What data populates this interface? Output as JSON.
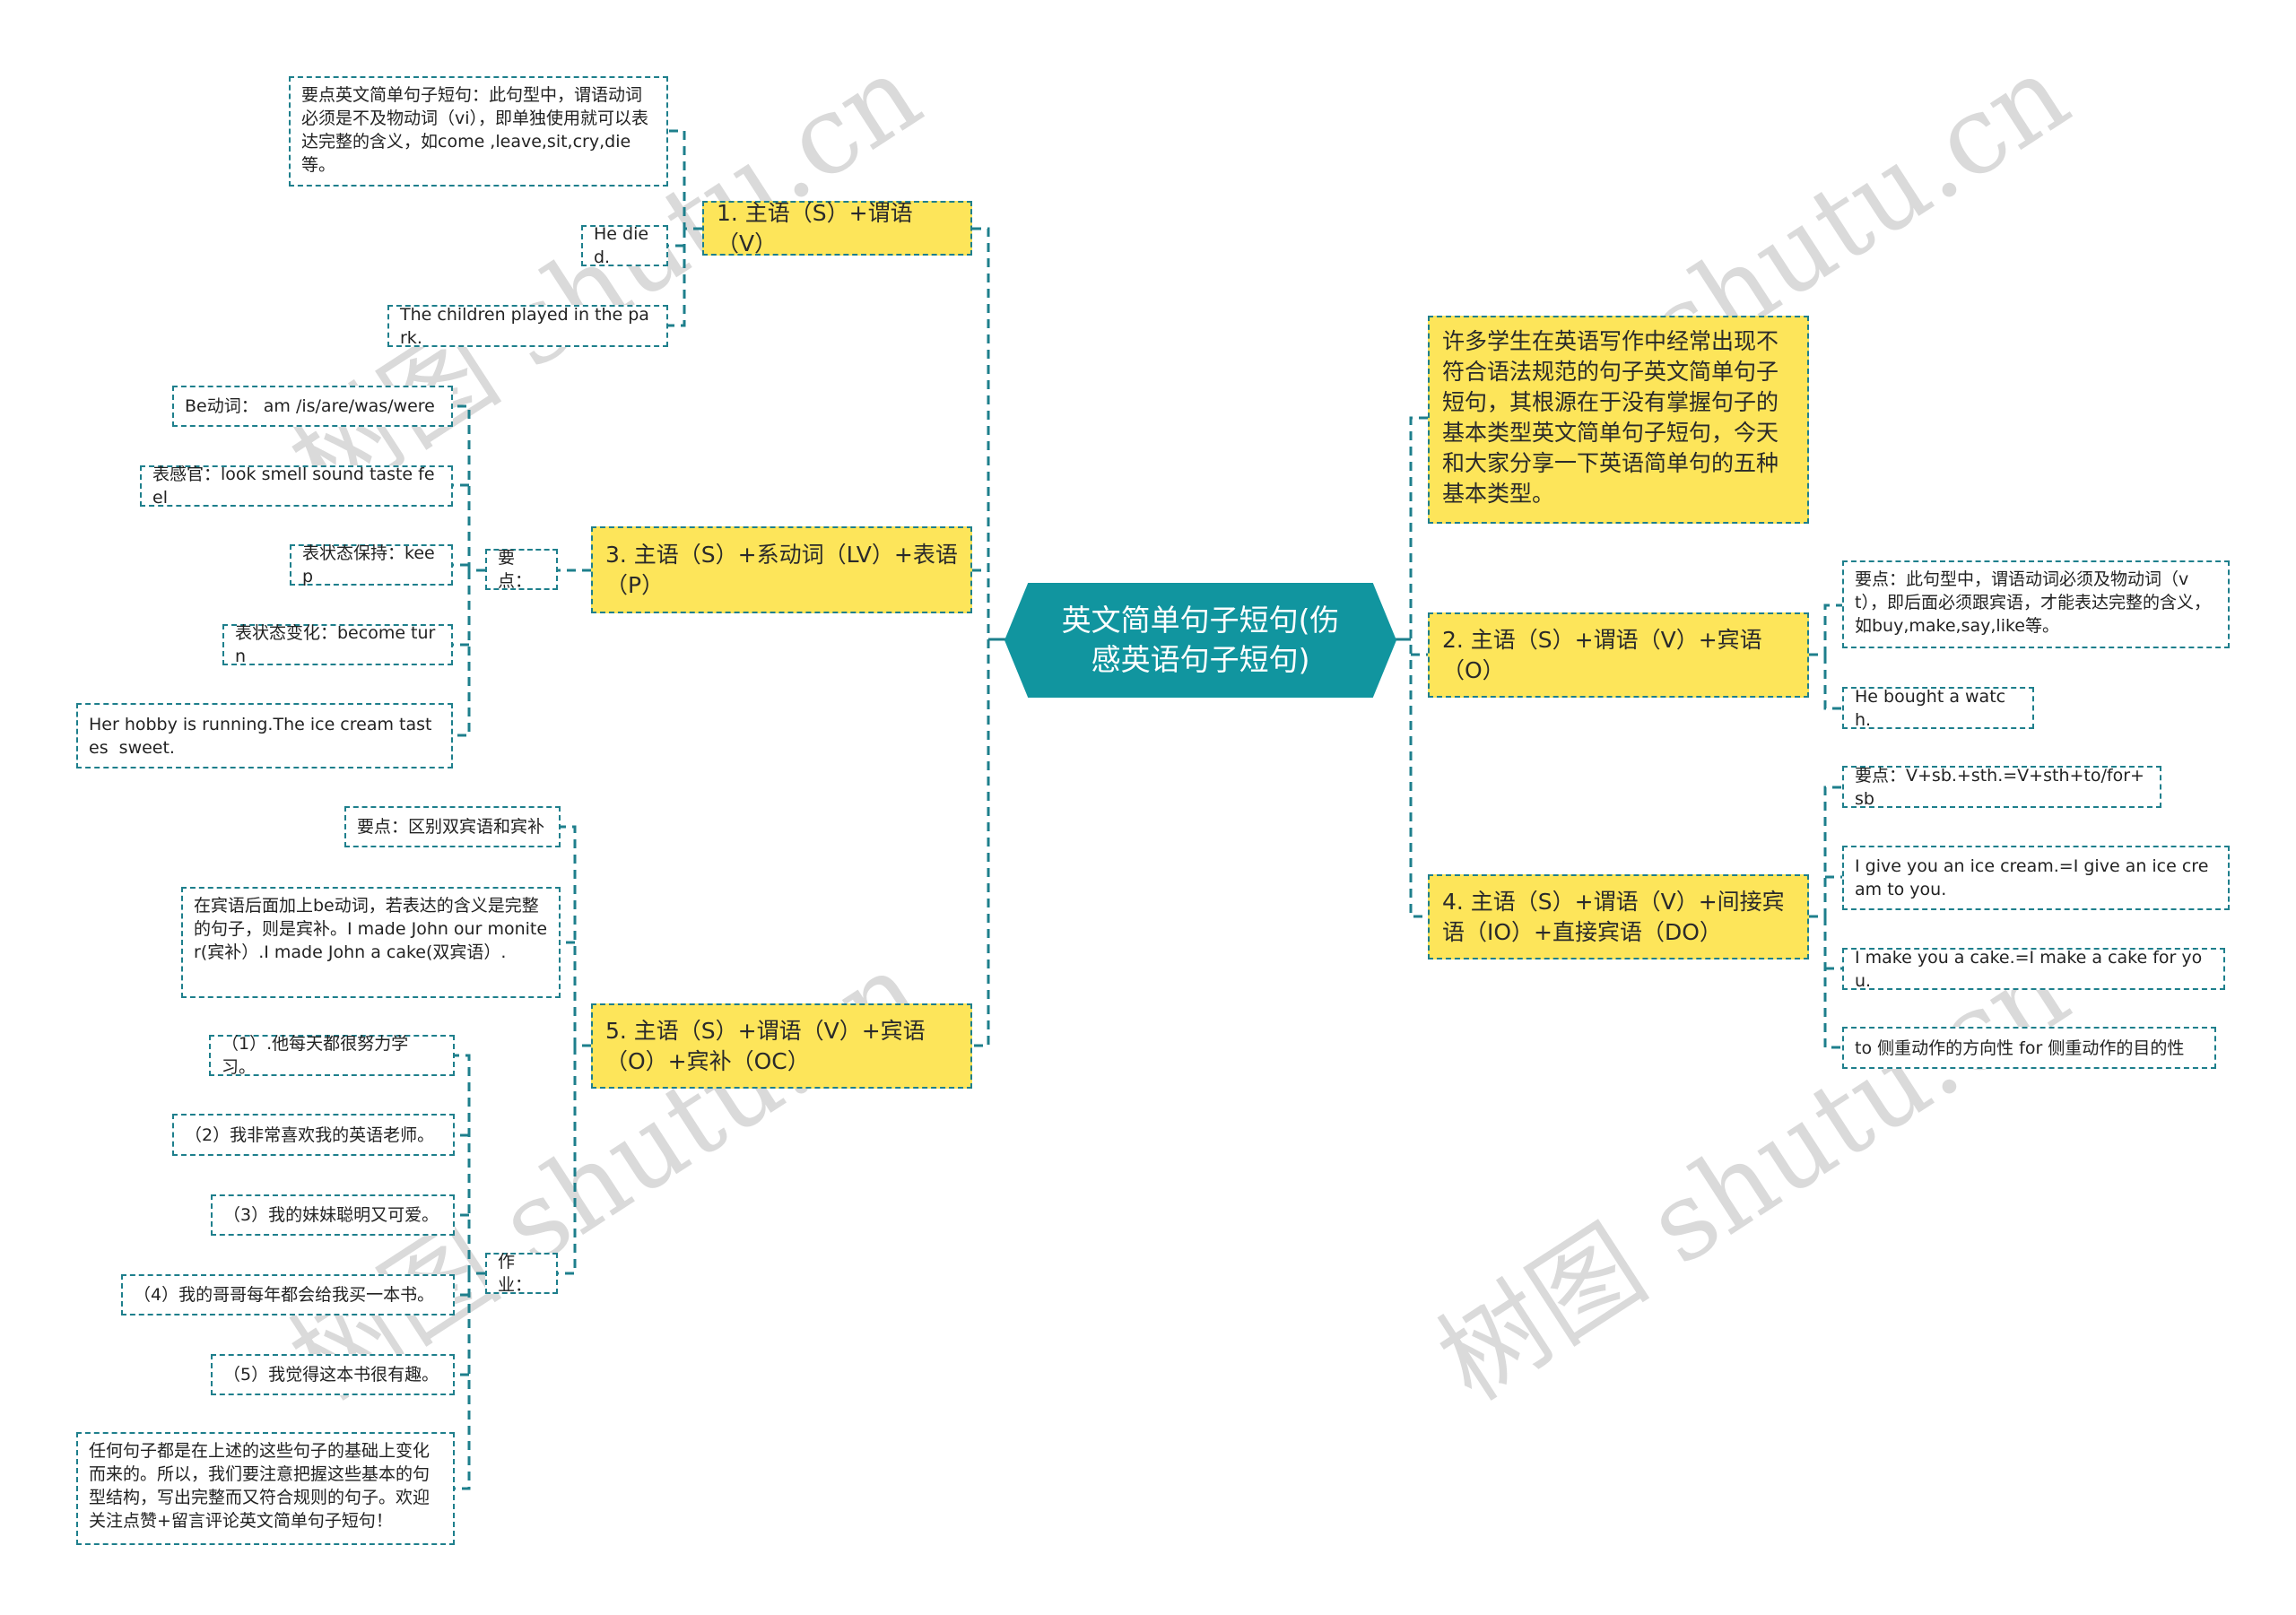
{
  "central_topic": "英文简单句子短句(伤感英语句子短句)",
  "watermark": "树图 shutu.cn",
  "colors": {
    "central_bg": "#11959f",
    "topic_bg": "#fde55a",
    "line": "#1e7f8c",
    "watermark": "#d4d4d4"
  },
  "left_branches": [
    {
      "label": "1. 主语（S）+谓语（V）",
      "children": [
        "要点英文简单句子短句：此句型中，谓语动词必须是不及物动词（vi），即单独使用就可以表达完整的含义，如come ,leave,sit,cry,die等。",
        "He died.",
        "The children played in the park."
      ]
    },
    {
      "label": "3. 主语（S）+系动词（LV）+表语（P）",
      "group_label": "要点：",
      "children": [
        "Be动词： am /is/are/was/were",
        "表感官：look smell sound taste feel",
        "表状态保持：keep",
        "表状态变化：become turn",
        "Her hobby is running.The ice cream tastes  sweet."
      ]
    },
    {
      "label": "5. 主语（S）+谓语（V）+宾语（O）+宾补（OC）",
      "children": [
        "要点：区别双宾语和宾补",
        "在宾语后面加上be动词，若表达的含义是完整的句子，则是宾补。I made John our moniter(宾补）.I made John a cake(双宾语）."
      ],
      "homework": {
        "label": "作业：",
        "items": [
          "（1）.他每天都很努力学习。",
          "（2）我非常喜欢我的英语老师。",
          "（3）我的妹妹聪明又可爱。",
          "（4）我的哥哥每年都会给我买一本书。",
          "（5）我觉得这本书很有趣。",
          "任何句子都是在上述的这些句子的基础上变化而来的。所以，我们要注意把握这些基本的句型结构，写出完整而又符合规则的句子。欢迎关注点赞+留言评论英文简单句子短句！"
        ]
      }
    }
  ],
  "right_branches": [
    {
      "label": "许多学生在英语写作中经常出现不符合语法规范的句子英文简单句子短句，其根源在于没有掌握句子的基本类型英文简单句子短句，今天和大家分享一下英语简单句的五种基本类型。"
    },
    {
      "label": "2. 主语（S）+谓语（V）+宾语（O）",
      "children": [
        "要点：此句型中，谓语动词必须及物动词（vt），即后面必须跟宾语，才能表达完整的含义，如buy,make,say,like等。",
        "He bought a watch."
      ]
    },
    {
      "label": "4. 主语（S）+谓语（V）+间接宾语（IO）+直接宾语（DO）",
      "children": [
        "要点：V+sb.+sth.=V+sth+to/for+sb",
        "I give you an ice cream.=I give an ice cream to you.",
        "I make you a cake.=I make a cake for you.",
        "to 侧重动作的方向性 for 侧重动作的目的性"
      ]
    }
  ]
}
